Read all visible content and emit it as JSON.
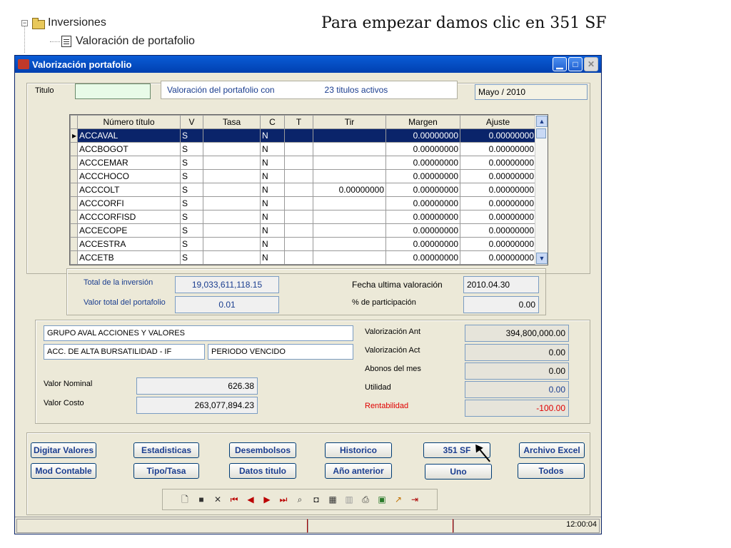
{
  "tree": {
    "node_label": "Inversiones",
    "child_label": "Valoración de portafolio",
    "expander": "−"
  },
  "caption": "Para empezar damos clic en 351 SF",
  "window": {
    "title": "Valorización portafolio",
    "min_icon": "minimize-icon",
    "max_icon": "maximize-icon",
    "close_icon": "close-icon"
  },
  "header": {
    "titulo_label": "Titulo",
    "titulo_value": "",
    "summary_prefix": "Valoración del portafolio con",
    "summary_count": "23  titulos activos",
    "period": "Mayo / 2010"
  },
  "grid": {
    "columns": [
      "Número título",
      "V",
      "Tasa",
      "C",
      "T",
      "Tir",
      "Margen",
      "Ajuste"
    ],
    "rows": [
      [
        "ACCAVAL",
        "S",
        "",
        "N",
        "",
        "",
        "0.00000000",
        "0.00000000"
      ],
      [
        "ACCBOGOT",
        "S",
        "",
        "N",
        "",
        "",
        "0.00000000",
        "0.00000000"
      ],
      [
        "ACCCEMAR",
        "S",
        "",
        "N",
        "",
        "",
        "0.00000000",
        "0.00000000"
      ],
      [
        "ACCCHOCO",
        "S",
        "",
        "N",
        "",
        "",
        "0.00000000",
        "0.00000000"
      ],
      [
        "ACCCOLT",
        "S",
        "",
        "N",
        "",
        "0.00000000",
        "0.00000000",
        "0.00000000"
      ],
      [
        "ACCCORFI",
        "S",
        "",
        "N",
        "",
        "",
        "0.00000000",
        "0.00000000"
      ],
      [
        "ACCCORFISD",
        "S",
        "",
        "N",
        "",
        "",
        "0.00000000",
        "0.00000000"
      ],
      [
        "ACCECOPE",
        "S",
        "",
        "N",
        "",
        "",
        "0.00000000",
        "0.00000000"
      ],
      [
        "ACCESTRA",
        "S",
        "",
        "N",
        "",
        "",
        "0.00000000",
        "0.00000000"
      ],
      [
        "ACCETB",
        "S",
        "",
        "N",
        "",
        "",
        "0.00000000",
        "0.00000000"
      ]
    ]
  },
  "totals": {
    "total_inversion_label": "Total de la inversión",
    "total_inversion": "19,033,611,118.15",
    "valor_total_label": "Valor total del portafolio",
    "valor_total": "0.01",
    "fecha_label": "Fecha ultima valoración",
    "fecha": "2010.04.30",
    "participacion_label": "% de participación",
    "participacion": "0.00"
  },
  "detail": {
    "issuer": "GRUPO AVAL ACCIONES Y VALORES",
    "class": "ACC. DE ALTA BURSATILIDAD - IF",
    "period_type": "PERIODO VENCIDO",
    "valor_nominal_label": "Valor Nominal",
    "valor_nominal": "626.38",
    "valor_costo_label": "Valor Costo",
    "valor_costo": "263,077,894.23",
    "val_ant_label": "Valorización Ant",
    "val_ant": "394,800,000.00",
    "val_act_label": "Valorización Act",
    "val_act": "0.00",
    "abonos_label": "Abonos del mes",
    "abonos": "0.00",
    "utilidad_label": "Utilidad",
    "utilidad": "0.00",
    "rentabilidad_label": "Rentabilidad",
    "rentabilidad": "-100.00"
  },
  "buttons": {
    "digitar": "Digitar Valores",
    "estadisticas": "Estadisticas",
    "desembolsos": "Desembolsos",
    "historico": "Historico",
    "sf351": "351 SF",
    "excel": "Archivo Excel",
    "mod_contable": "Mod Contable",
    "tipo_tasa": "Tipo/Tasa",
    "datos_titulo": "Datos titulo",
    "anio_anterior": "Año anterior",
    "uno": "Uno",
    "todos": "Todos"
  },
  "status": {
    "clock": "12:00:04"
  },
  "colors": {
    "selection": "#0a246a",
    "negative": "#e00000",
    "link_blue": "#1a3d8f"
  }
}
